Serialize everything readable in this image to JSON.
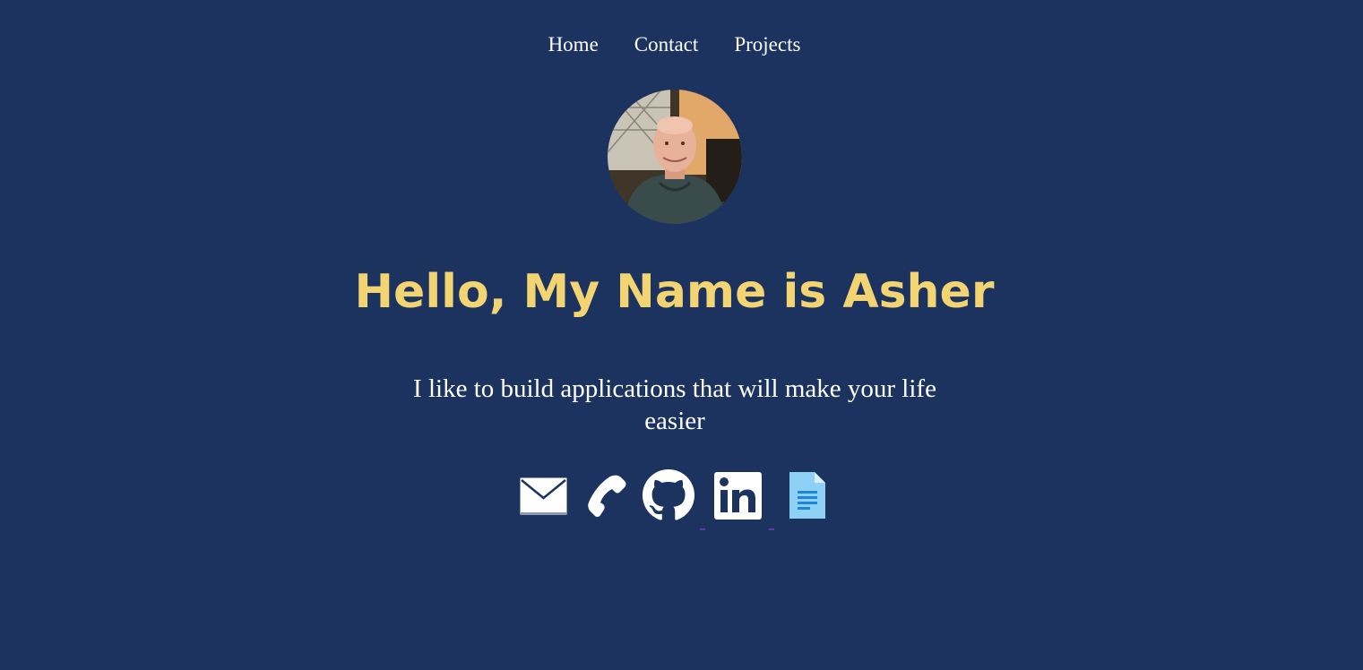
{
  "nav": {
    "items": [
      {
        "label": "Home"
      },
      {
        "label": "Contact"
      },
      {
        "label": "Projects"
      }
    ]
  },
  "hero": {
    "title": "Hello, My Name is Asher",
    "tagline": "I like to build applications that will make your life easier"
  },
  "social": {
    "icons": [
      "envelope-icon",
      "phone-icon",
      "github-icon",
      "linkedin-icon",
      "document-icon"
    ]
  },
  "colors": {
    "background": "#1c3360",
    "title": "#f2d572",
    "text": "#ffffff",
    "document_icon": "#8fd0f7"
  }
}
